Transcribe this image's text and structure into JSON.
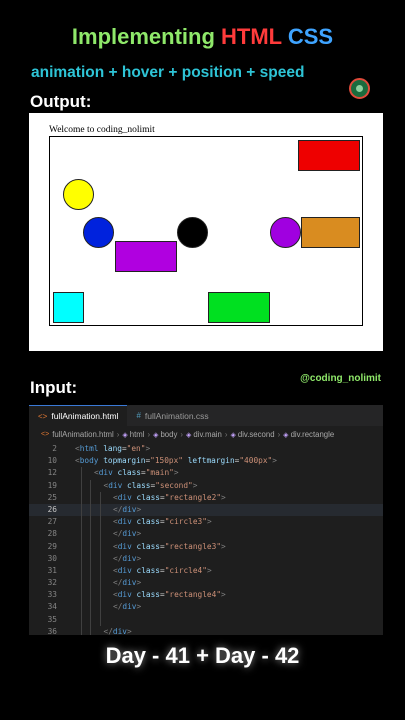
{
  "header": {
    "title_part1": "Implementing",
    "title_part2": "HTML",
    "title_part3": "CSS",
    "subtitle": "animation + hover + position + speed",
    "logo_icon": "coding-nolimit-logo-icon"
  },
  "output": {
    "label": "Output:",
    "welcome_text": "Welcome to coding_nolimit",
    "shape_colors": {
      "red": "#ee0000",
      "yellow": "#ffff00",
      "blue": "#0022dd",
      "purple_rect": "#b000e0",
      "black": "#000000",
      "purple_circle": "#a000e0",
      "orange": "#d98c20",
      "cyan": "#00ffff",
      "green": "#00e020"
    }
  },
  "input": {
    "label": "Input:",
    "handle": "@coding_nolimit"
  },
  "editor": {
    "tabs": [
      {
        "label": "fullAnimation.html",
        "icon": "<>"
      },
      {
        "label": "fullAnimation.css",
        "icon": "#"
      }
    ],
    "breadcrumbs": [
      "fullAnimation.html",
      "html",
      "body",
      "div.main",
      "div.second",
      "div.rectangle"
    ],
    "current_line": "26",
    "lines": [
      {
        "n": "2",
        "text": "<html lang=\"en\">"
      },
      {
        "n": "10",
        "text": "<body topmargin=\"150px\" leftmargin=\"400px\">"
      },
      {
        "n": "12",
        "text": "<div class=\"main\">"
      },
      {
        "n": "19",
        "text": "<div class=\"second\">"
      },
      {
        "n": "25",
        "text": "<div class=\"rectangle2\">"
      },
      {
        "n": "26",
        "text": "</div>"
      },
      {
        "n": "27",
        "text": "<div class=\"circle3\">"
      },
      {
        "n": "28",
        "text": "</div>"
      },
      {
        "n": "29",
        "text": "<div class=\"rectangle3\">"
      },
      {
        "n": "30",
        "text": "</div>"
      },
      {
        "n": "31",
        "text": "<div class=\"circle4\">"
      },
      {
        "n": "32",
        "text": "</div>"
      },
      {
        "n": "33",
        "text": "<div class=\"rectangle4\">"
      },
      {
        "n": "34",
        "text": "</div>"
      },
      {
        "n": "35",
        "text": ""
      },
      {
        "n": "36",
        "text": "</div>"
      }
    ]
  },
  "footer": {
    "text": "Day - 41 + Day - 42"
  }
}
